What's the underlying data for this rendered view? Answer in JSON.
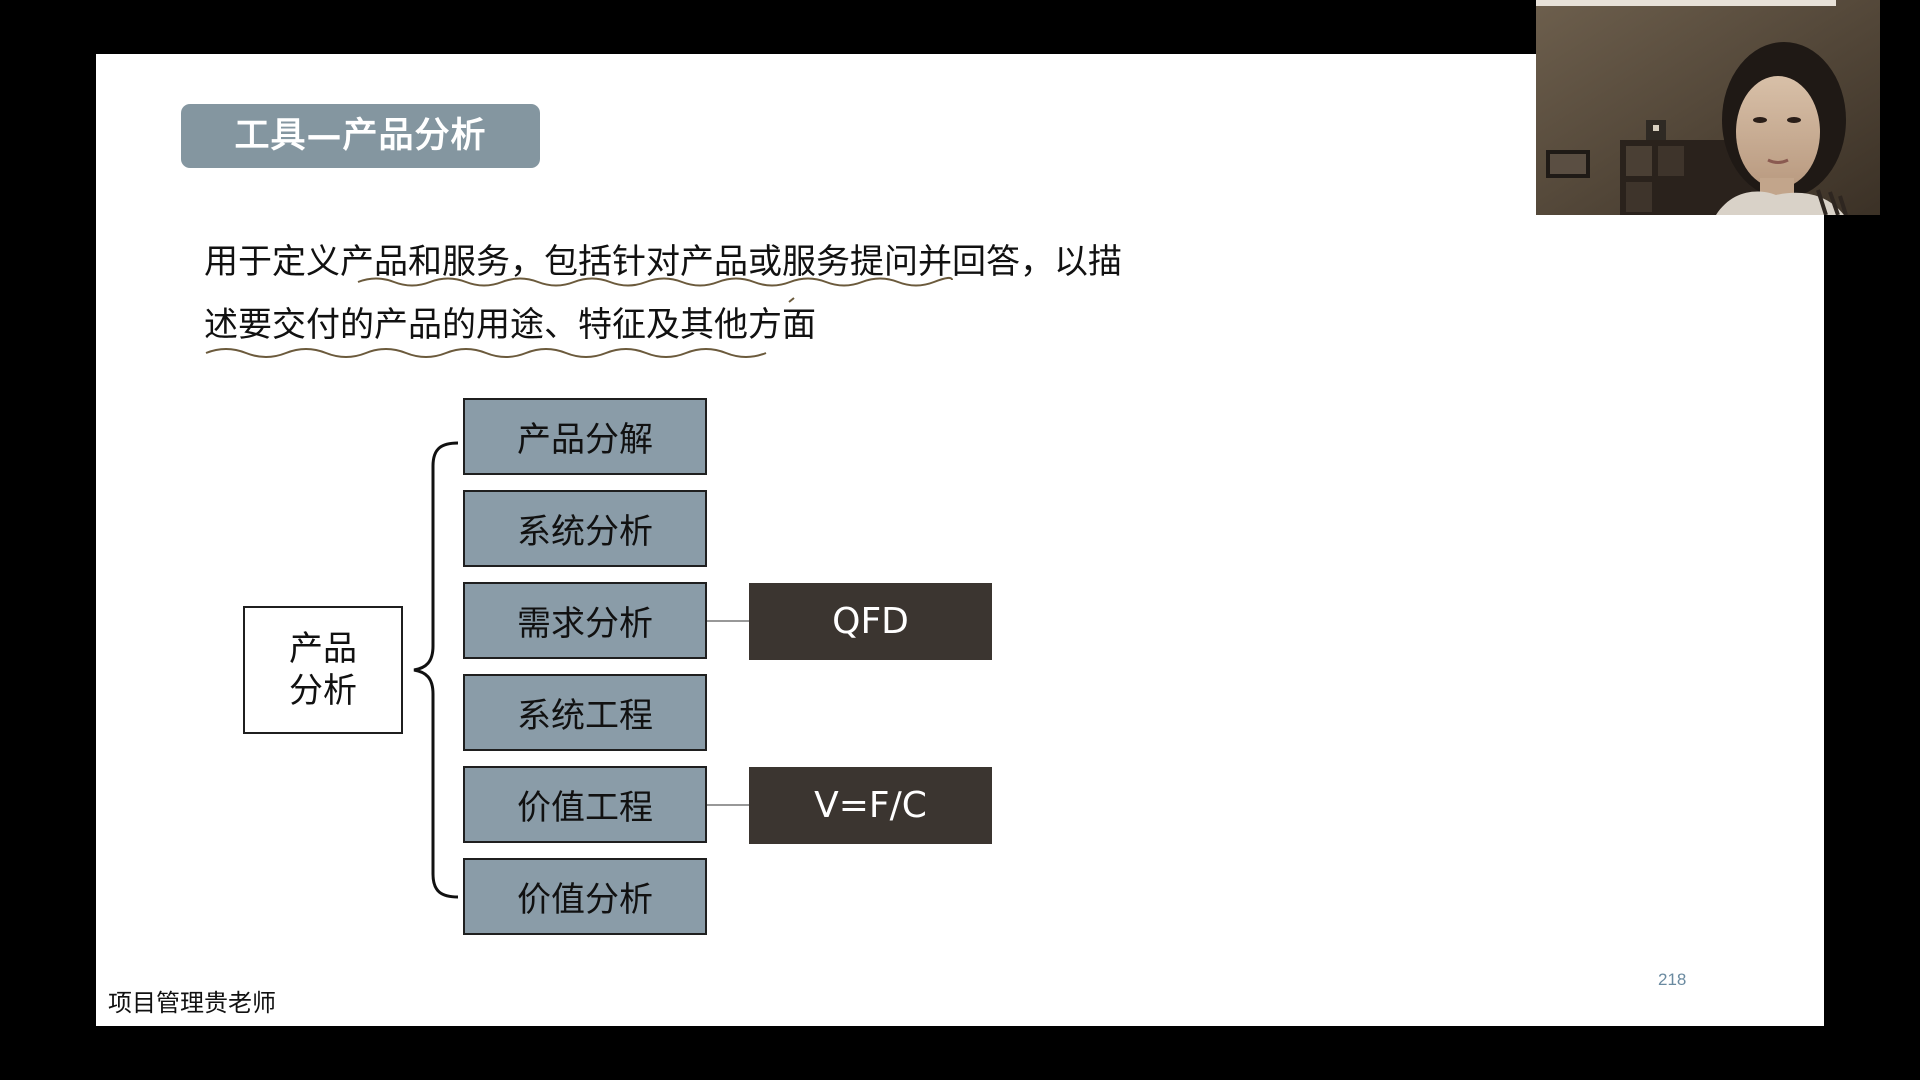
{
  "slide": {
    "title": "工具—产品分析",
    "description_line_1": "用于定义产品和服务，包括针对产品或服务提问并回答，以描",
    "description_line_2": "述要交付的产品的用途、特征及其他方面",
    "diagram": {
      "root_line_1": "产品",
      "root_line_2": "分析",
      "branches": [
        "产品分解",
        "系统分析",
        "需求分析",
        "系统工程",
        "价值工程",
        "价值分析"
      ],
      "tools": [
        "QFD",
        "V=F/C"
      ]
    },
    "watermark": "项目管理贵老师",
    "page_number": "218"
  },
  "webcam": {
    "icon": "presenter-video"
  },
  "colors": {
    "title_badge": "#8496a0",
    "branch_fill": "#8a9ca8",
    "tool_fill": "#3b3530",
    "page_number": "#6a8aa0",
    "annotation": "#6b5a3c"
  }
}
